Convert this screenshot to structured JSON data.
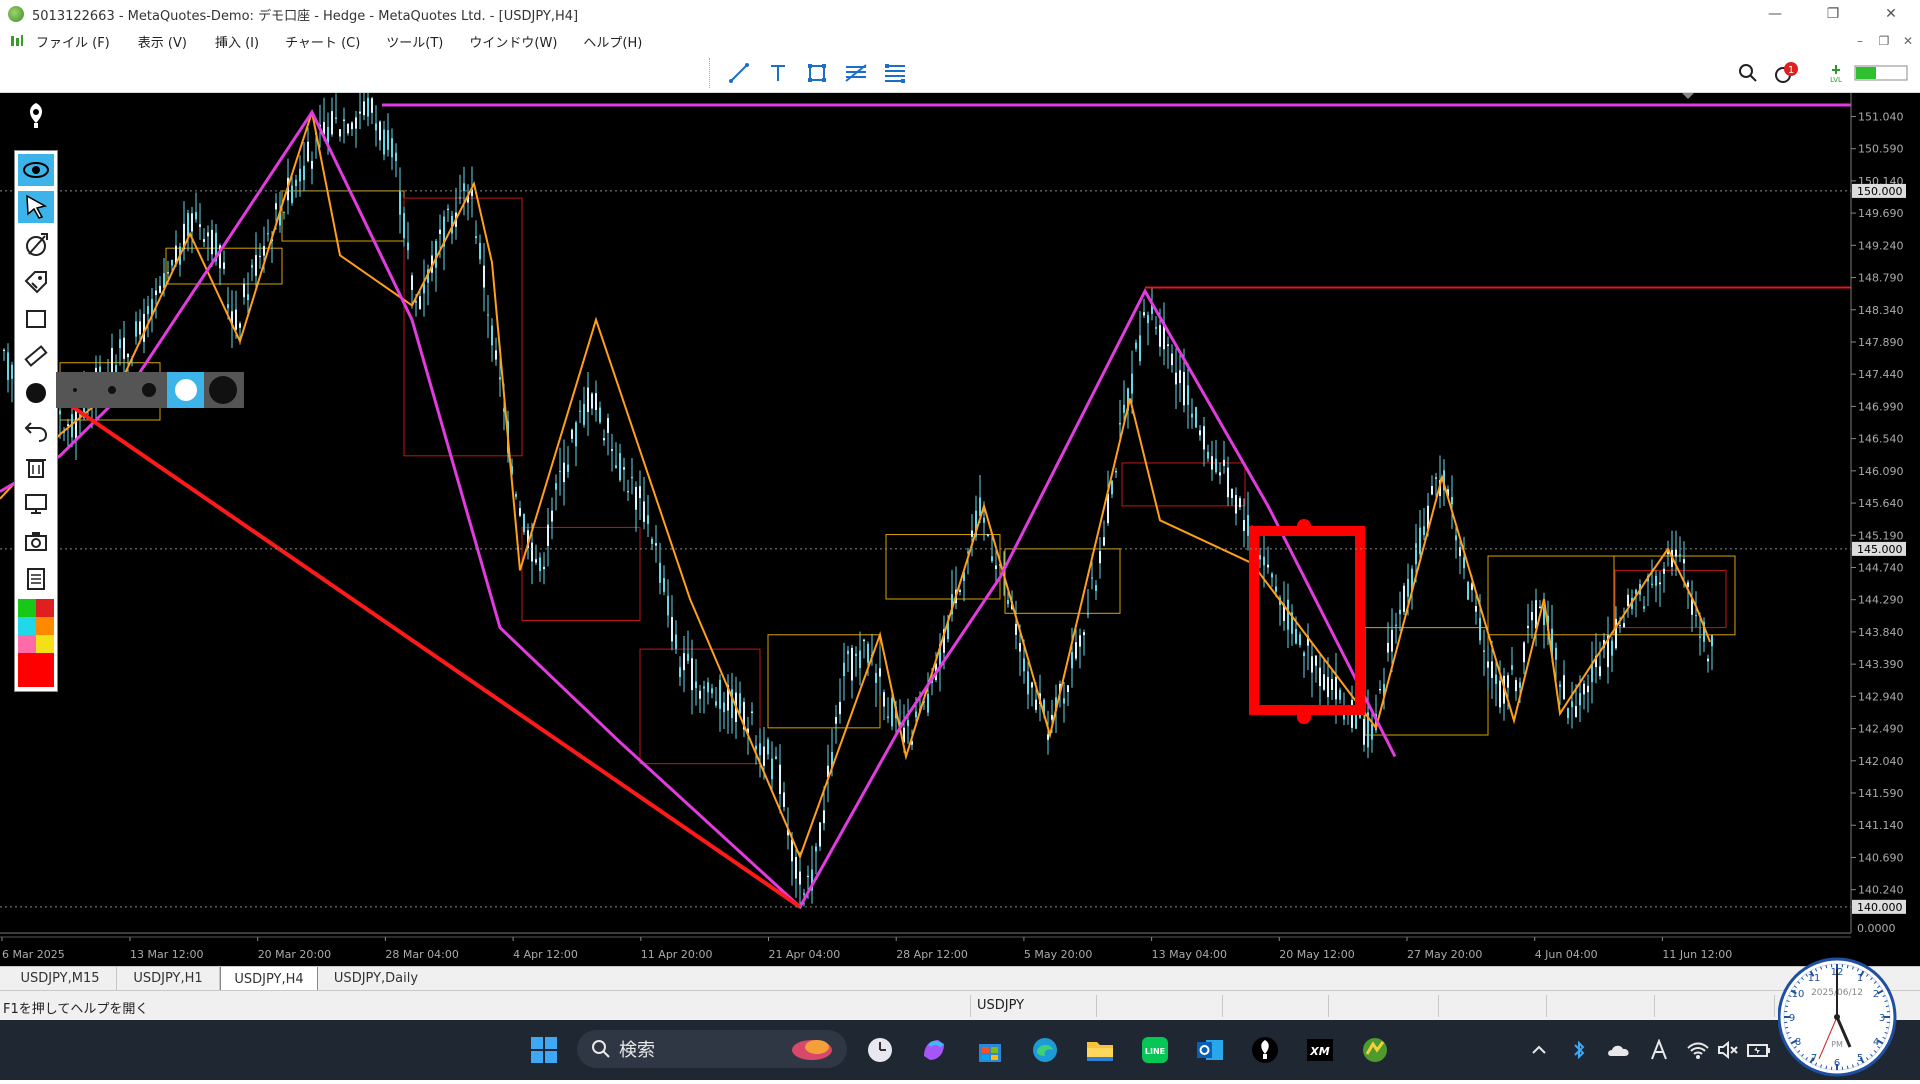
{
  "window": {
    "title": "5013122663 - MetaQuotes-Demo: デモ口座 - Hedge - MetaQuotes Ltd. - [USDJPY,H4]",
    "minimize": "—",
    "maximize": "❐",
    "close": "✕"
  },
  "menu": {
    "items": [
      "ファイル (F)",
      "表示 (V)",
      "挿入 (I)",
      "チャート (C)",
      "ツール(T)",
      "ウインドウ(W)",
      "ヘルプ(H)"
    ],
    "mdi_minimize": "–",
    "mdi_restore": "❐",
    "mdi_close": "✕"
  },
  "toolbar": {
    "drawing_tools": [
      "trendline-tool",
      "text-tool",
      "rectangle-tool",
      "fibonacci-tool",
      "fibo-channel-tool"
    ],
    "notification_count": "1",
    "level_label": "LVL"
  },
  "price_axis": {
    "labels": [
      "151.040",
      "150.590",
      "150.140",
      "149.690",
      "149.240",
      "148.790",
      "148.340",
      "147.890",
      "147.440",
      "146.990",
      "146.540",
      "146.090",
      "145.640",
      "145.190",
      "144.740",
      "144.290",
      "143.840",
      "143.390",
      "142.940",
      "142.490",
      "142.040",
      "141.590",
      "141.140",
      "140.690",
      "140.240"
    ],
    "marked_levels": [
      "150.000",
      "145.000",
      "140.000"
    ],
    "bottom_value": "0.0000"
  },
  "time_axis": {
    "labels": [
      "6 Mar 2025",
      "13 Mar 12:00",
      "20 Mar 20:00",
      "28 Mar 04:00",
      "4 Apr 12:00",
      "11 Apr 20:00",
      "21 Apr 04:00",
      "28 Apr 12:00",
      "5 May 20:00",
      "13 May 04:00",
      "20 May 12:00",
      "27 May 20:00",
      "4 Jun 04:00",
      "11 Jun 12:00"
    ]
  },
  "chart_data": {
    "type": "candlestick",
    "symbol": "USDJPY",
    "timeframe": "H4",
    "ylim": [
      139.9,
      151.3
    ],
    "x_range": [
      "6 Mar 2025",
      "11 Jun 12:00"
    ],
    "grid": false,
    "background": "#000000",
    "colors": {
      "candles": "#66d9e8",
      "zigzag_major": "#e23be0",
      "zigzag_minor": "#ff9f1a",
      "boxes_orange": "#d9a400",
      "boxes_red": "#c01818",
      "horizontal_line": "#e23be0",
      "resistance_line": "#e01818",
      "diagonal_line": "#ff1a1a",
      "highlight_rect": "#ff0000"
    },
    "key_points": [
      {
        "label": "high",
        "date": "28 Mar",
        "price": 151.2
      },
      {
        "label": "low",
        "date": "21 Apr",
        "price": 139.9
      },
      {
        "label": "swing high",
        "date": "12 May",
        "price": 148.65
      }
    ],
    "horizontal_levels": [
      151.2,
      148.65,
      150.0,
      145.0,
      140.0
    ]
  },
  "drawing_panel": {
    "tools": [
      "pen-icon",
      "eye-icon",
      "cursor-icon",
      "eraser-icon",
      "label-icon",
      "rectangle-icon",
      "ruler-icon",
      "brush-size-icon",
      "undo-icon",
      "trash-icon",
      "screen-icon",
      "camera-icon",
      "notes-icon"
    ],
    "palette": [
      "#18c818",
      "#e02020",
      "#22d8e8",
      "#ff8a00",
      "#ff6aa8",
      "#f4e018",
      "#ff0000"
    ]
  },
  "tabs": [
    "USDJPY,M15",
    "USDJPY,H1",
    "USDJPY,H4",
    "USDJPY,Daily"
  ],
  "active_tab": "USDJPY,H4",
  "status": {
    "help_text": "F1を押してヘルプを開く",
    "symbol": "USDJPY"
  },
  "taskbar": {
    "search_label": "検索",
    "clock_date": "2025/06/12",
    "clock_ampm": "PM"
  }
}
